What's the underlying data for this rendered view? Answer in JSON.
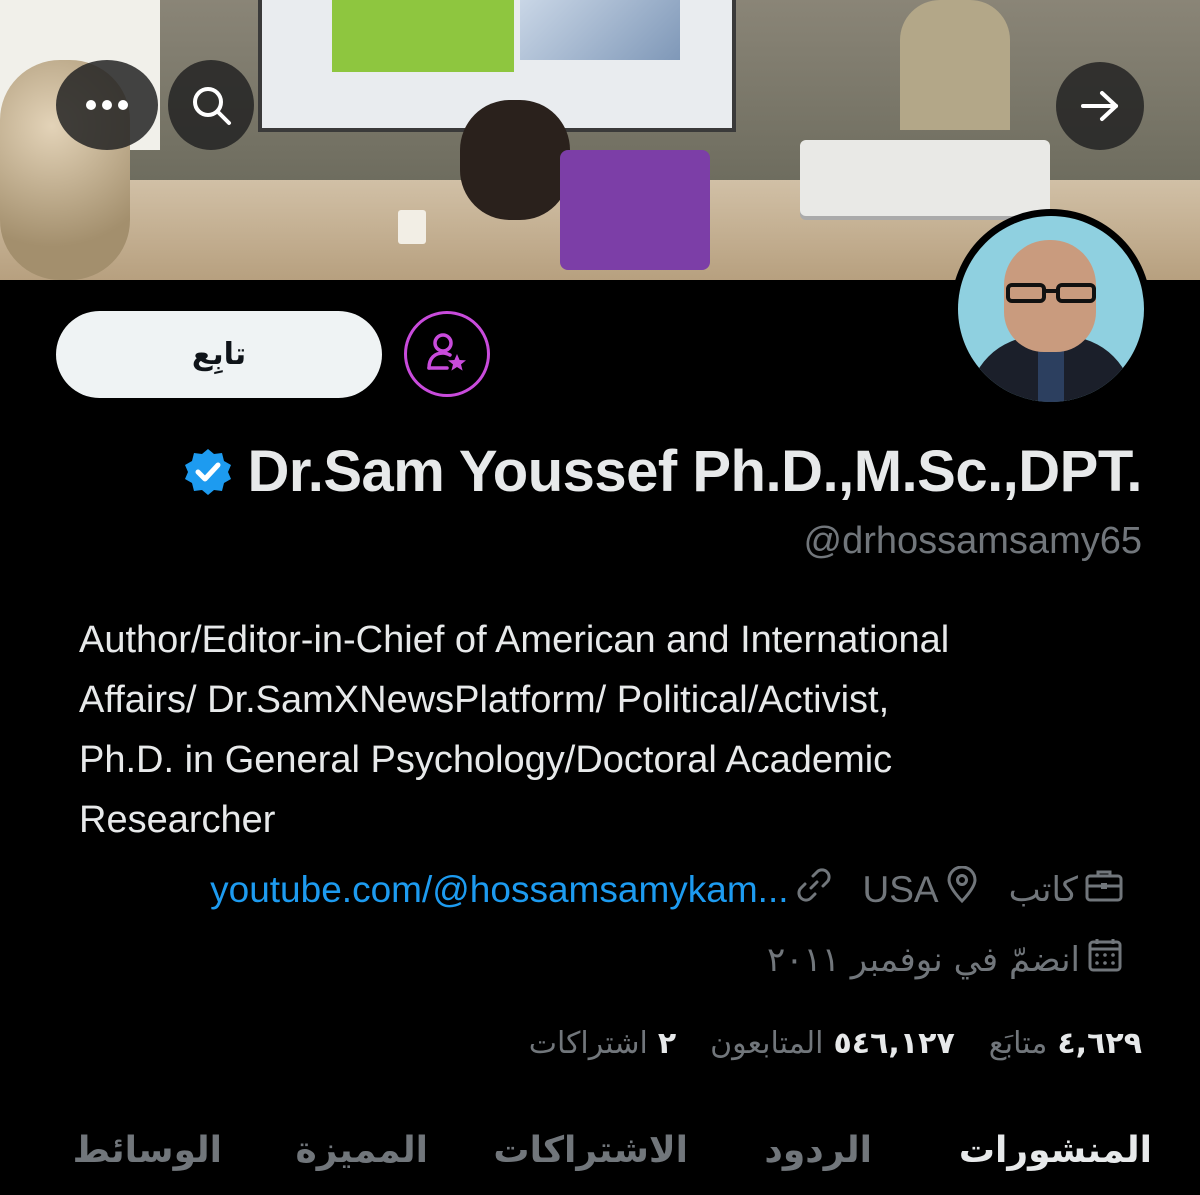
{
  "banner": {
    "more_icon": "more-horizontal-icon",
    "search_icon": "search-icon",
    "forward_icon": "arrow-right-icon"
  },
  "profile": {
    "follow_label": "تابِع",
    "subscribe_icon": "person-star-icon",
    "name": "Dr.Sam Youssef Ph.D.,M.Sc.,DPT.",
    "handle": "@drhossamsamy65",
    "verified_color": "#1d9bf0",
    "bio_lines": [
      "Author/Editor-in-Chief of American and International",
      "Affairs/ Dr.SamXNewsPlatform/ Political/Activist,",
      "Ph.D. in General Psychology/Doctoral Academic",
      "Researcher"
    ],
    "profession": "كاتب",
    "location": "USA",
    "website": "youtube.com/@hossamsamykam...",
    "joined": "انضمّ في نوفمبر ٢٠١١"
  },
  "stats": {
    "following_count": "٤,٦٢٩",
    "following_label": "متابَع",
    "followers_count": "٥٤٦,١٢٧",
    "followers_label": "المتابعون",
    "subscriptions_count": "٢",
    "subscriptions_label": "اشتراكات"
  },
  "tabs": [
    "المنشورات",
    "الردود",
    "الاشتراكات",
    "المميزة",
    "الوسائط"
  ],
  "colors": {
    "accent": "#1d9bf0",
    "subscribe_ring": "#c94bdc",
    "muted": "#71767b",
    "text": "#e7e9ea"
  }
}
